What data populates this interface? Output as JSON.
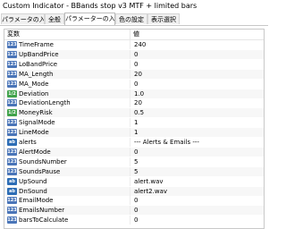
{
  "window": {
    "title": "Custom Indicator - BBands stop v3 MTF + limited bars"
  },
  "tabs": [
    {
      "label": "パラメータの入力"
    },
    {
      "label": "全般"
    },
    {
      "label": "パラメーターの入力"
    },
    {
      "label": "色の設定"
    },
    {
      "label": "表示選択"
    }
  ],
  "table": {
    "headers": {
      "variable": "変数",
      "value": "値"
    },
    "rows": [
      {
        "type": "int",
        "icon": "integer-icon",
        "name": "TimeFrame",
        "value": "240"
      },
      {
        "type": "int",
        "icon": "integer-icon",
        "name": "UpBandPrice",
        "value": "0"
      },
      {
        "type": "int",
        "icon": "integer-icon",
        "name": "LoBandPrice",
        "value": "0"
      },
      {
        "type": "int",
        "icon": "integer-icon",
        "name": "MA_Length",
        "value": "20"
      },
      {
        "type": "int",
        "icon": "integer-icon",
        "name": "MA_Mode",
        "value": "0"
      },
      {
        "type": "dbl",
        "icon": "double-icon",
        "name": "Deviation",
        "value": "1.0"
      },
      {
        "type": "int",
        "icon": "integer-icon",
        "name": "DeviationLength",
        "value": "20"
      },
      {
        "type": "dbl",
        "icon": "double-icon",
        "name": "MoneyRisk",
        "value": "0.5"
      },
      {
        "type": "int",
        "icon": "integer-icon",
        "name": "SignalMode",
        "value": "1"
      },
      {
        "type": "int",
        "icon": "integer-icon",
        "name": "LineMode",
        "value": "1"
      },
      {
        "type": "ab",
        "icon": "string-icon",
        "name": "alerts",
        "value": "--- Alerts & Emails ---"
      },
      {
        "type": "int",
        "icon": "integer-icon",
        "name": "AlertMode",
        "value": "0"
      },
      {
        "type": "int",
        "icon": "integer-icon",
        "name": "SoundsNumber",
        "value": "5"
      },
      {
        "type": "int",
        "icon": "integer-icon",
        "name": "SoundsPause",
        "value": "5"
      },
      {
        "type": "ab",
        "icon": "string-icon",
        "name": "UpSound",
        "value": "alert.wav"
      },
      {
        "type": "ab",
        "icon": "string-icon",
        "name": "DnSound",
        "value": "alert2.wav"
      },
      {
        "type": "int",
        "icon": "integer-icon",
        "name": "EmailMode",
        "value": "0"
      },
      {
        "type": "int",
        "icon": "integer-icon",
        "name": "EmailsNumber",
        "value": "0"
      },
      {
        "type": "int",
        "icon": "integer-icon",
        "name": "barsToCalculate",
        "value": "0"
      }
    ]
  },
  "icon_glyphs": {
    "int": "123",
    "dbl": "1/2",
    "ab": "ab"
  },
  "colors": {
    "int_icon": "#4a75b8",
    "dbl_icon": "#3fa24a",
    "str_icon": "#2d6db5"
  }
}
